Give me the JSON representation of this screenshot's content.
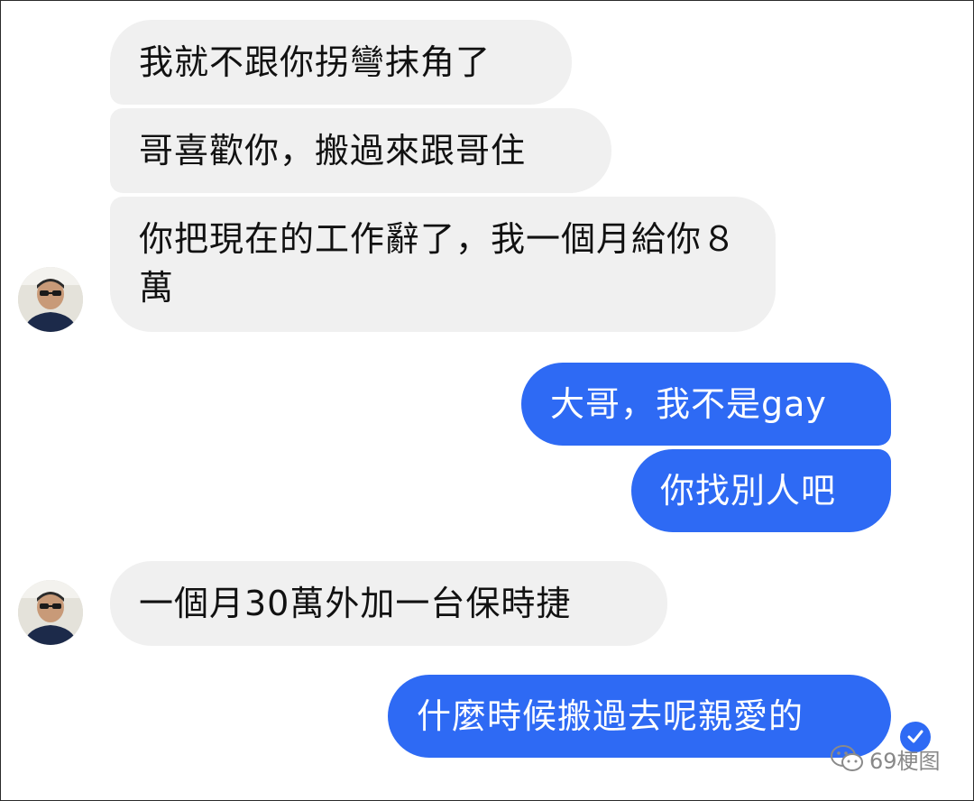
{
  "conversation": {
    "messages": [
      {
        "sender": "other",
        "text": "我就不跟你拐彎抹角了"
      },
      {
        "sender": "other",
        "text": "哥喜歡你，搬過來跟哥住"
      },
      {
        "sender": "other",
        "text": "你把現在的工作辭了，我一個月給你８萬"
      },
      {
        "sender": "me",
        "text": "大哥，我不是gay"
      },
      {
        "sender": "me",
        "text": "你找別人吧"
      },
      {
        "sender": "other",
        "text": "一個月30萬外加一台保時捷"
      },
      {
        "sender": "me",
        "text": "什麼時候搬過去呢親愛的"
      }
    ]
  },
  "icons": {
    "avatar": "avatar",
    "read_receipt": "check-circle-icon",
    "watermark": "wechat-icon"
  },
  "colors": {
    "incoming_bubble": "#f0f0f0",
    "outgoing_bubble": "#2e6af4",
    "incoming_text": "#111111",
    "outgoing_text": "#ffffff"
  },
  "watermark": {
    "text": "69梗图"
  }
}
